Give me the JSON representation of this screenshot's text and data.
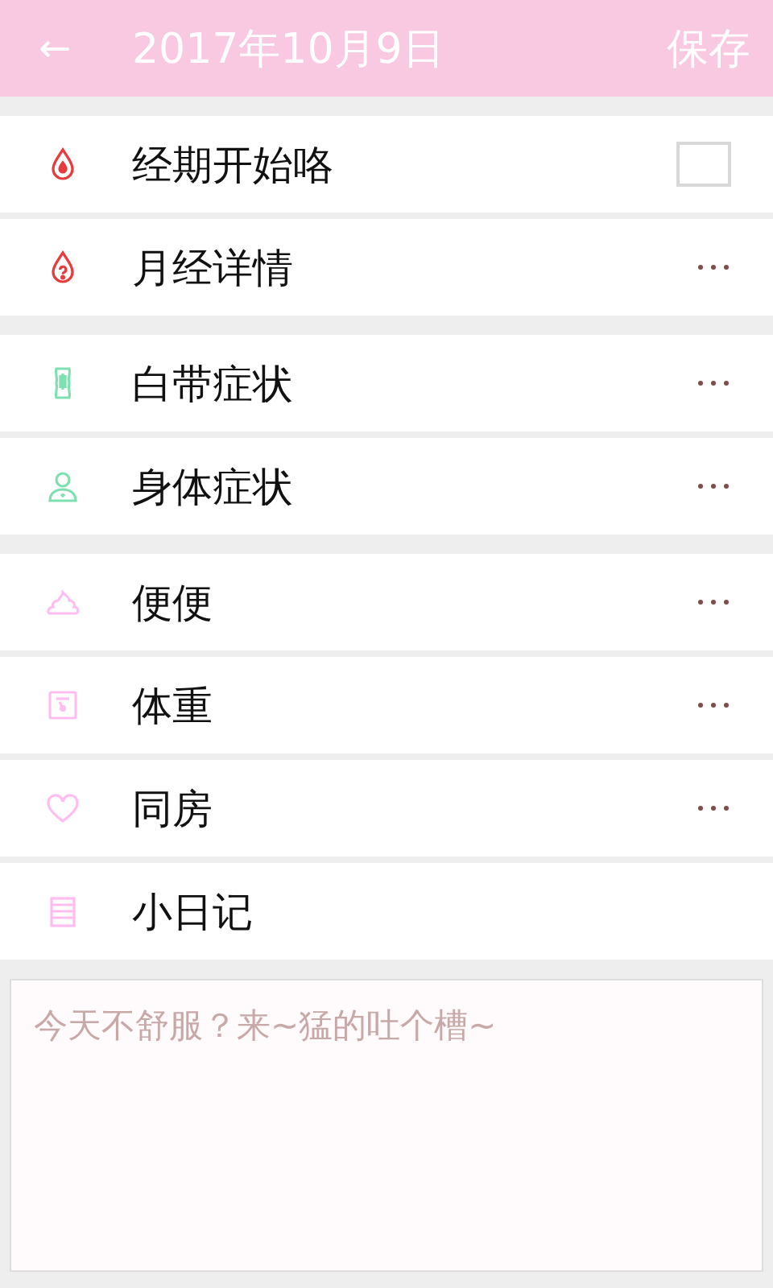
{
  "header": {
    "back": "←",
    "title": "2017年10月9日",
    "action": "保存"
  },
  "sections": [
    {
      "items": [
        {
          "label": "经期开始咯",
          "kind": "checkbox",
          "checked": false
        },
        {
          "label": "月经详情",
          "kind": "more"
        }
      ]
    },
    {
      "items": [
        {
          "label": "白带症状",
          "kind": "more"
        },
        {
          "label": "身体症状",
          "kind": "more"
        }
      ]
    },
    {
      "items": [
        {
          "label": "便便",
          "kind": "more"
        },
        {
          "label": "体重",
          "kind": "more"
        },
        {
          "label": "同房",
          "kind": "more"
        },
        {
          "label": "小日记",
          "kind": "plain"
        }
      ]
    }
  ],
  "diary": {
    "placeholder": "今天不舒服？来~猛的吐个槽~"
  }
}
